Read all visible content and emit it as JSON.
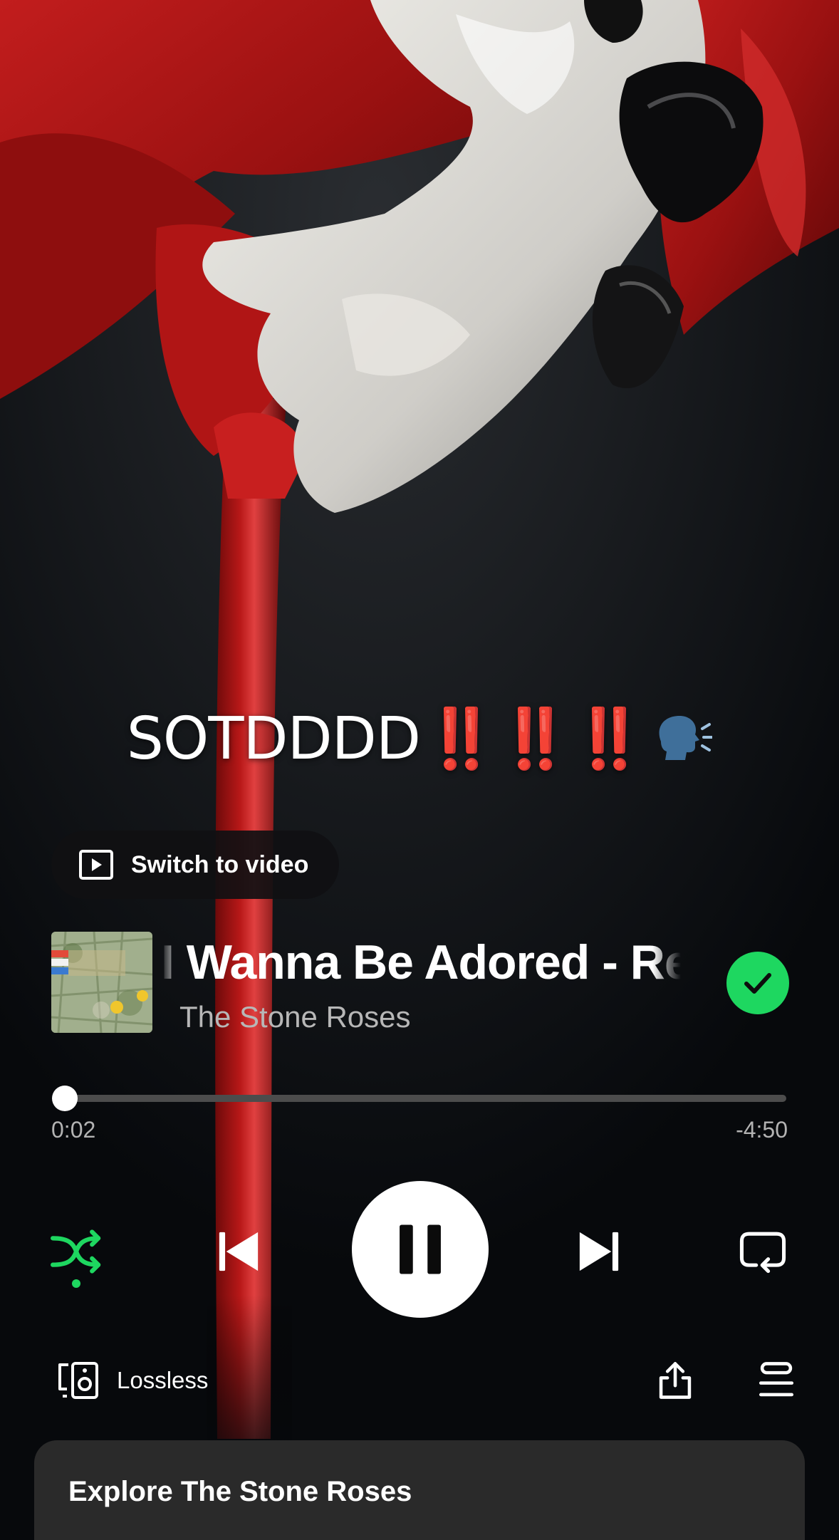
{
  "caption": {
    "text": "SOTDDDD",
    "emphasis": "‼️‼️‼️",
    "emoji_icon": "speaking-head-icon"
  },
  "switch_to_video": {
    "label": "Switch to video",
    "icon": "video-play-icon"
  },
  "track": {
    "title": "I Wanna Be Adored - Remastered",
    "artist": "The Stone Roses",
    "cover_icon": "album-cover-the-stone-roses",
    "in_library": true
  },
  "progress": {
    "elapsed": "0:02",
    "remaining": "-4:50",
    "fraction": 0.007
  },
  "controls": {
    "shuffle_icon": "shuffle-icon",
    "shuffle_active": true,
    "previous_icon": "skip-previous-icon",
    "play_state_icon": "pause-icon",
    "next_icon": "skip-next-icon",
    "repeat_icon": "repeat-icon"
  },
  "bottom": {
    "device_label": "Lossless",
    "device_icon": "connect-device-icon",
    "share_icon": "share-icon",
    "queue_icon": "queue-icon"
  },
  "explore": {
    "title": "Explore The Stone Roses"
  },
  "colors": {
    "accent_green": "#1ed760",
    "background": "#07090c",
    "caption_red": "#e3221f",
    "secondary_text": "#b3b3b3"
  }
}
